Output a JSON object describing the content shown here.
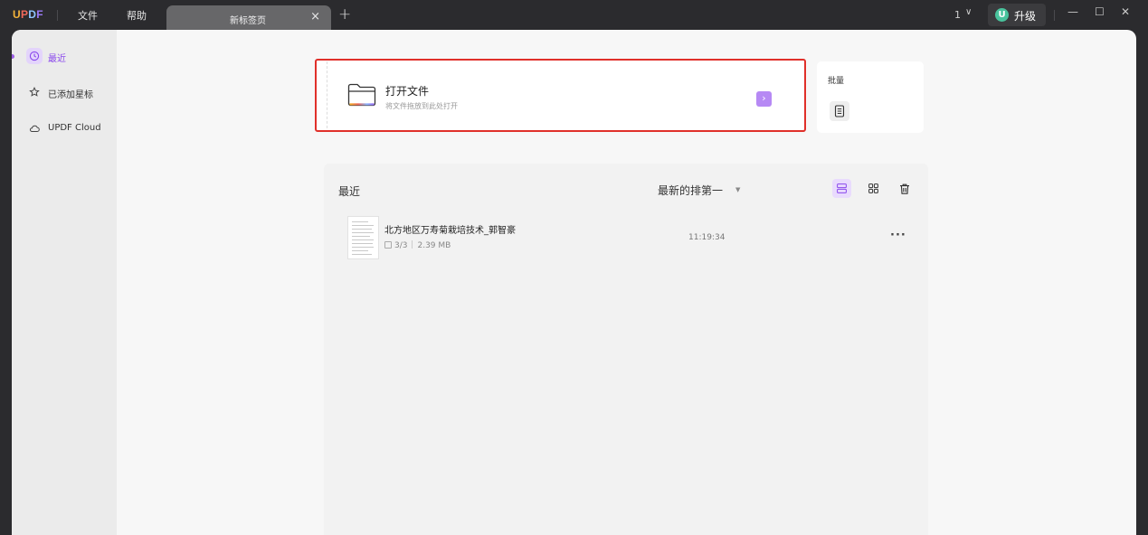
{
  "app": {
    "logo": {
      "u": "U",
      "p": "P",
      "d": "D",
      "f": "F"
    },
    "menu": {
      "file": "文件",
      "help": "帮助"
    },
    "tab": {
      "title": "新标签页",
      "close_glyph": "×",
      "add_glyph": "+"
    },
    "window": {
      "count": "1",
      "chevron": "∨",
      "upgrade_avatar": "U",
      "upgrade_label": "升级",
      "minimize": "—",
      "maximize": "☐",
      "close": "✕"
    },
    "accent_color": "#8a48ec"
  },
  "sidebar": {
    "items": [
      {
        "label": "最近",
        "icon": "clock-icon",
        "active": true
      },
      {
        "label": "已添加星标",
        "icon": "star-icon",
        "active": false
      },
      {
        "label": "UPDF Cloud",
        "icon": "cloud-icon",
        "active": false
      }
    ]
  },
  "open_file": {
    "title": "打开文件",
    "subtitle": "将文件拖放到此处打开",
    "arrow": "›"
  },
  "batch": {
    "title": "批量"
  },
  "recent": {
    "title": "最近",
    "sort_label": "最新的排第一",
    "sort_caret": "▼",
    "files": [
      {
        "name": "北方地区万寿菊栽培技术_郭智豪",
        "pages": "3/3",
        "size": "2.39 MB",
        "time": "11:19:34",
        "more": "···"
      }
    ]
  }
}
